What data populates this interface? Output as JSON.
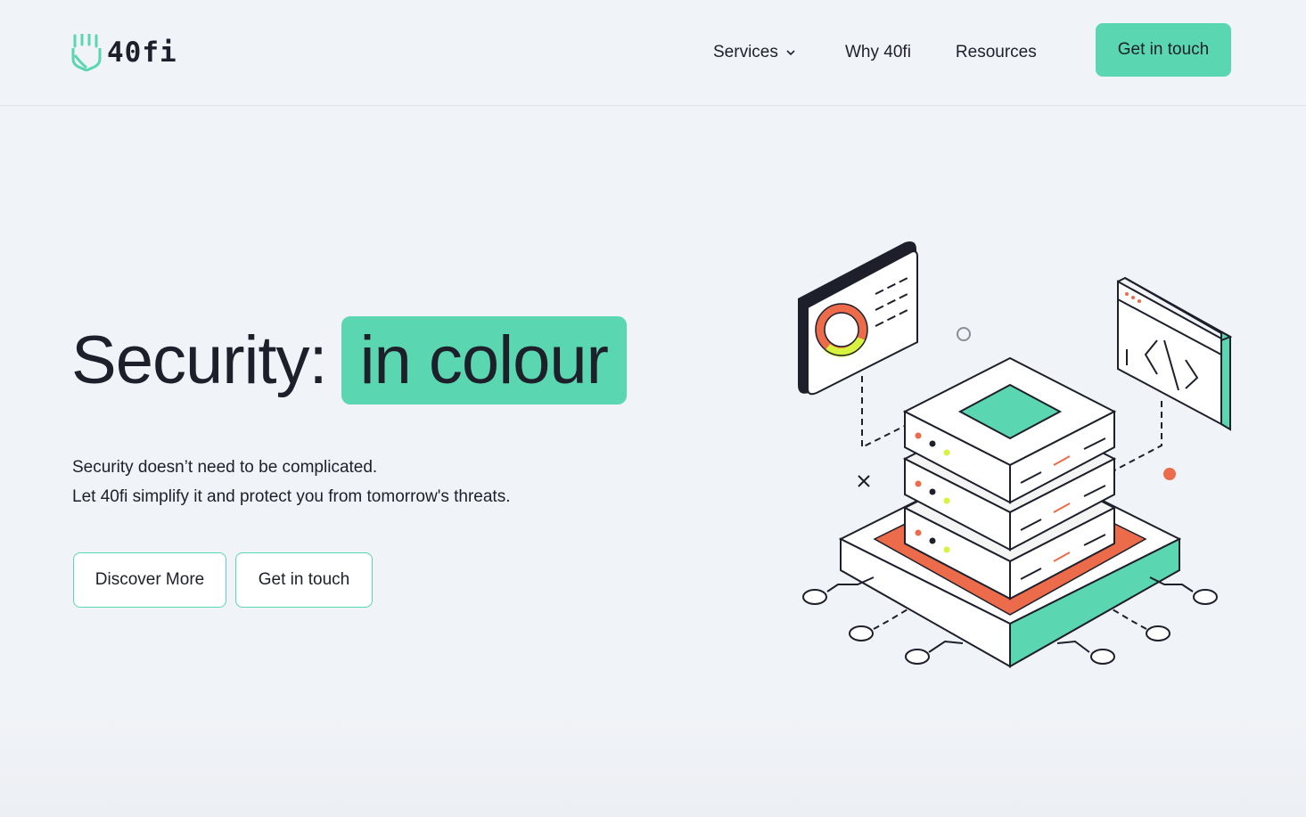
{
  "brand": {
    "logo_text": "40fi",
    "accent_color": "#5ad6b0",
    "orange_color": "#eb6b4a",
    "lime_color": "#d8f23e"
  },
  "nav": {
    "items": [
      {
        "label": "Services",
        "has_dropdown": true
      },
      {
        "label": "Why 40fi"
      },
      {
        "label": "Resources"
      }
    ],
    "cta_label": "Get in touch"
  },
  "hero": {
    "title_plain": "Security:",
    "title_highlight": "in colour",
    "subtitle_line1": "Security doesn’t need to be complicated.",
    "subtitle_line2": "Let 40fi simplify it and protect you from tomorrow's threats.",
    "button_primary": "Discover More",
    "button_secondary": "Get in touch"
  },
  "illustration": {
    "icons": [
      "chart-window-icon",
      "code-window-icon",
      "server-stack-icon"
    ]
  }
}
